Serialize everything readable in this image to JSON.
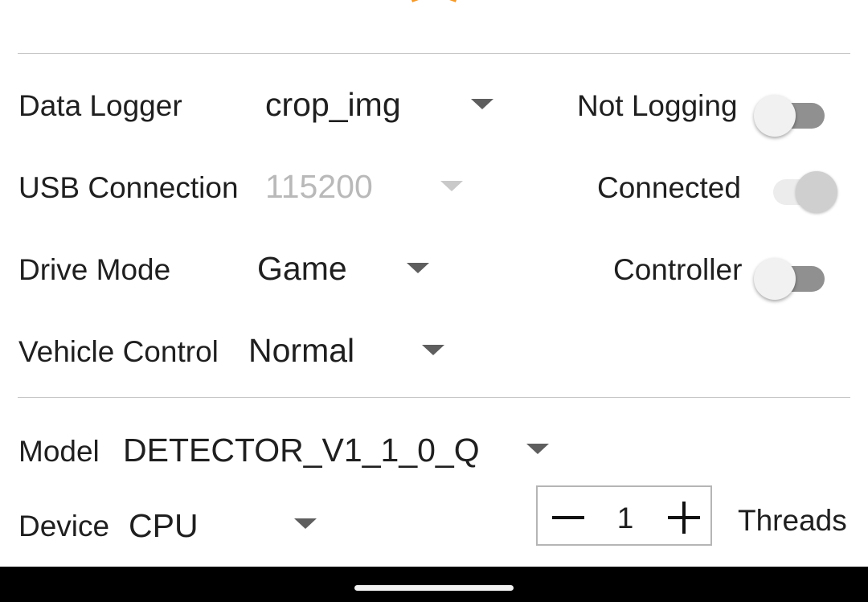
{
  "colors": {
    "accent": "#f39a28",
    "nav_bar": "#000000",
    "divider": "#c6c6c6"
  },
  "top": {
    "logo_icon": "hexagon-logo-icon"
  },
  "data_logger": {
    "label": "Data Logger",
    "value": "crop_img",
    "status_label": "Not Logging",
    "toggle_on": false
  },
  "usb_connection": {
    "label": "USB Connection",
    "value": "115200",
    "status_label": "Connected",
    "toggle_on": true,
    "enabled": false
  },
  "drive_mode": {
    "label": "Drive Mode",
    "value": "Game",
    "status_label": "Controller",
    "toggle_on": false
  },
  "vehicle_control": {
    "label": "Vehicle Control",
    "value": "Normal"
  },
  "model": {
    "label": "Model",
    "value": "DETECTOR_V1_1_0_Q"
  },
  "device": {
    "label": "Device",
    "value": "CPU"
  },
  "threads": {
    "label": "Threads",
    "count": "1",
    "minus_icon": "minus-icon",
    "plus_icon": "plus-icon"
  },
  "nav": {
    "handle_icon": "home-gesture-handle"
  }
}
